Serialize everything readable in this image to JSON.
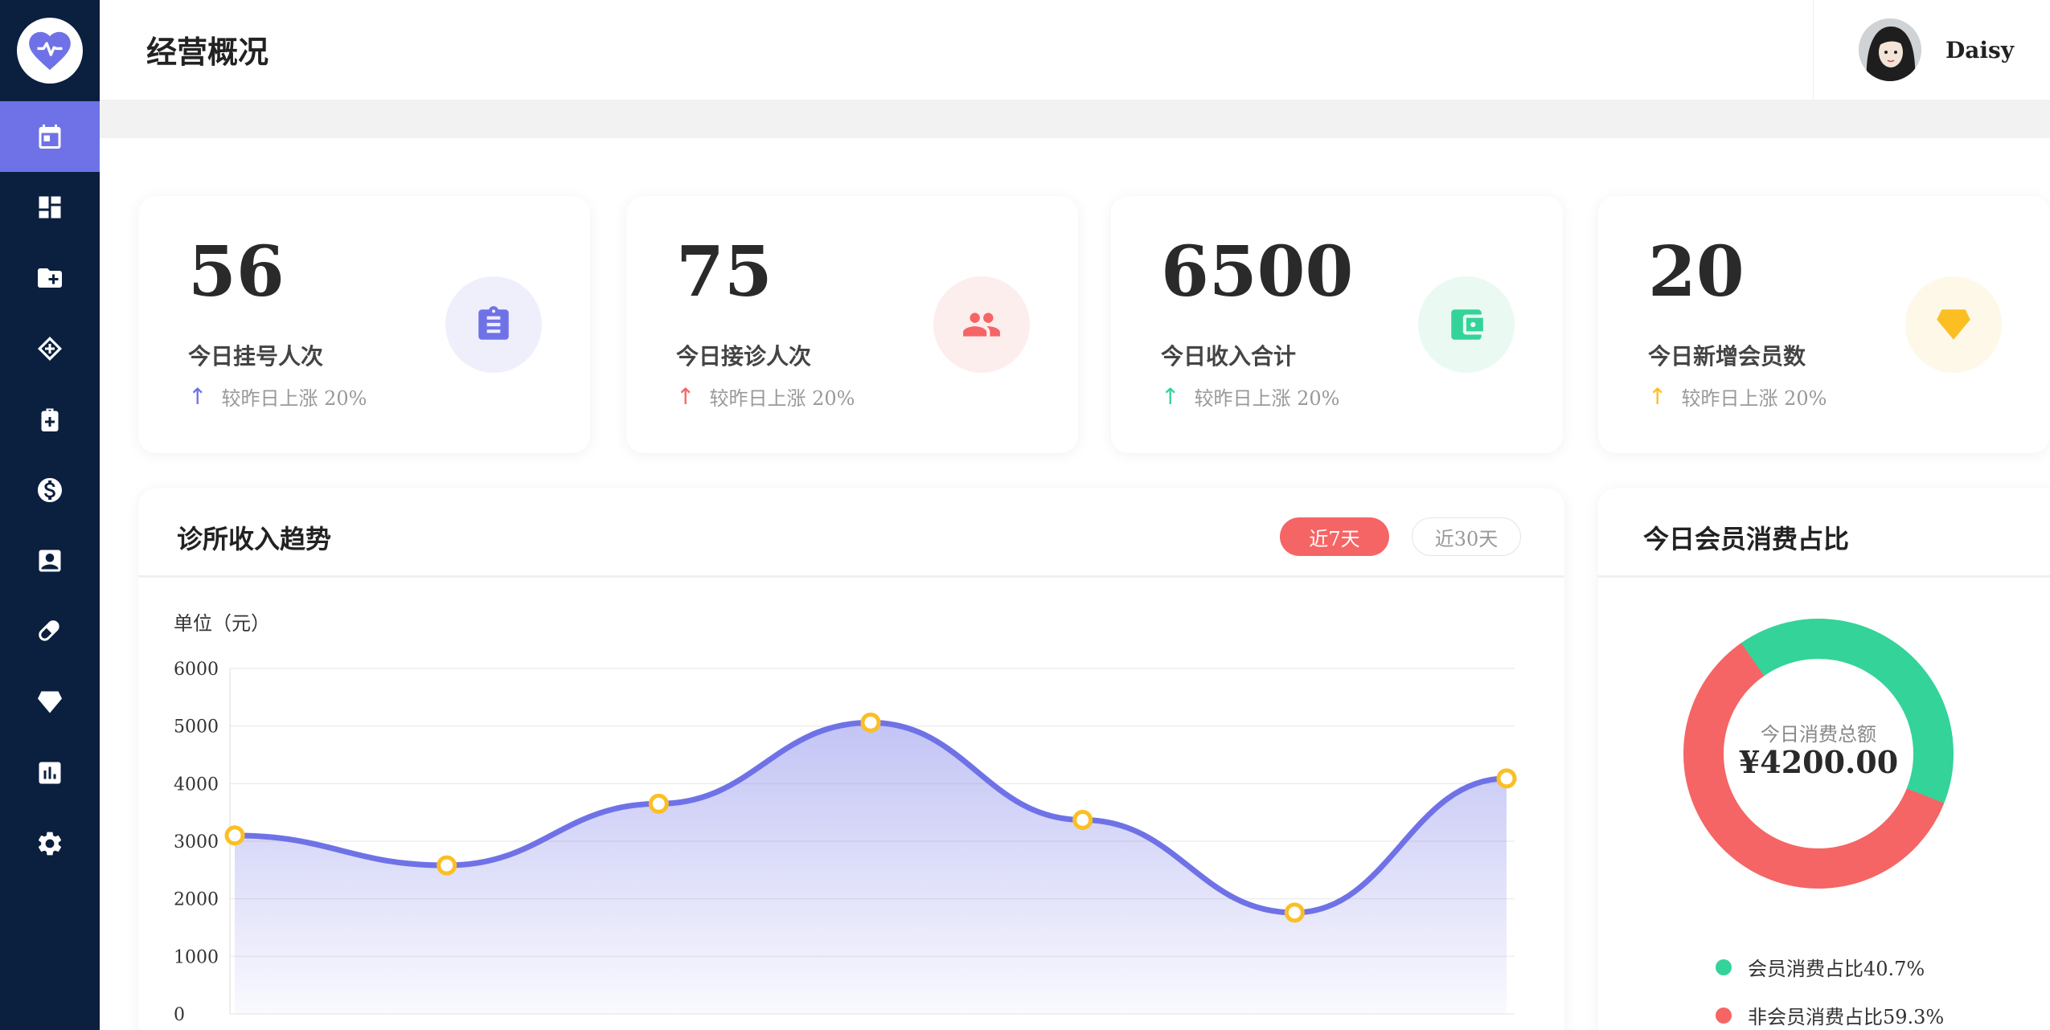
{
  "header": {
    "title": "经营概况",
    "user_name": "Daisy"
  },
  "sidebar": {
    "items": [
      {
        "icon": "calendar-icon",
        "active": true
      },
      {
        "icon": "dashboard-icon",
        "active": false
      },
      {
        "icon": "folder-add-icon",
        "active": false
      },
      {
        "icon": "ticket-icon",
        "active": false
      },
      {
        "icon": "medical-kit-icon",
        "active": false
      },
      {
        "icon": "dollar-icon",
        "active": false
      },
      {
        "icon": "contact-card-icon",
        "active": false
      },
      {
        "icon": "pill-icon",
        "active": false
      },
      {
        "icon": "diamond-icon",
        "active": false
      },
      {
        "icon": "bar-chart-icon",
        "active": false
      },
      {
        "icon": "gear-icon",
        "active": false
      }
    ]
  },
  "stats": [
    {
      "value": "56",
      "label": "今日挂号人次",
      "delta": "较昨日上涨 20%",
      "color": "#6f72e6",
      "bg": "#efeffc",
      "icon": "clipboard-icon"
    },
    {
      "value": "75",
      "label": "今日接诊人次",
      "delta": "较昨日上涨 20%",
      "color": "#f56565",
      "bg": "#fdeeee",
      "icon": "people-icon"
    },
    {
      "value": "6500",
      "label": "今日收入合计",
      "delta": "较昨日上涨 20%",
      "color": "#34d399",
      "bg": "#eafaf3",
      "icon": "wallet-icon"
    },
    {
      "value": "20",
      "label": "今日新增会员数",
      "delta": "较昨日上涨 20%",
      "color": "#fbbf24",
      "bg": "#fef8e8",
      "icon": "diamond-icon"
    }
  ],
  "trend": {
    "title": "诊所收入趋势",
    "pill_7": "近7天",
    "pill_30": "近30天",
    "unit": "单位（元）"
  },
  "chart_data": [
    {
      "type": "area",
      "title": "诊所收入趋势",
      "ylabel": "单位（元）",
      "ylim": [
        0,
        6000
      ],
      "yticks": [
        0,
        1000,
        2000,
        3000,
        4000,
        5000,
        6000
      ],
      "values": [
        3100,
        2580,
        3650,
        5060,
        3370,
        1760,
        4090
      ],
      "grid": true,
      "colors": {
        "line": "#6f72e6",
        "marker": "#fbbf24"
      }
    },
    {
      "type": "pie",
      "title": "今日会员消费占比",
      "center_label": "今日消费总额",
      "center_value": "¥4200.00",
      "slices": [
        {
          "label": "会员消费占比40.7%",
          "value": 40.7,
          "color": "#34d399"
        },
        {
          "label": "非会员消费占比59.3%",
          "value": 59.3,
          "color": "#f56565"
        }
      ]
    }
  ]
}
